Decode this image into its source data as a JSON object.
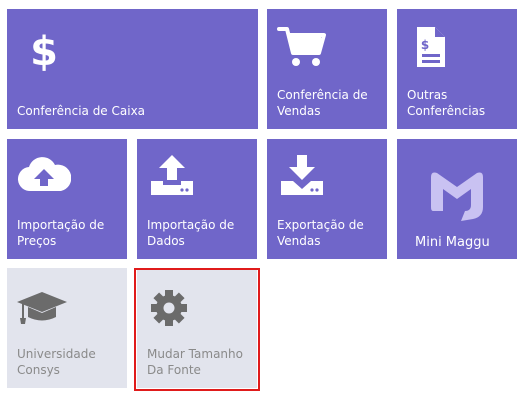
{
  "tiles": {
    "conferencia_caixa": {
      "label": "Conferência de Caixa",
      "icon": "dollar-icon"
    },
    "conferencia_vendas": {
      "label": "Conferência de\nVendas",
      "icon": "shopping-cart-icon"
    },
    "outras_conferencias": {
      "label": "Outras\nConferências",
      "icon": "invoice-icon"
    },
    "importacao_precos": {
      "label": "Importação de\nPreços",
      "icon": "cloud-upload-icon"
    },
    "importacao_dados": {
      "label": "Importação de\nDados",
      "icon": "upload-icon"
    },
    "exportacao_vendas": {
      "label": "Exportação de\nVendas",
      "icon": "download-icon"
    },
    "mini_maggu": {
      "label": "Mini Maggu",
      "icon": "maggu-logo-icon"
    },
    "universidade_consys": {
      "label": "Universidade\nConsys",
      "icon": "graduation-cap-icon"
    },
    "mudar_tamanho_fonte": {
      "label": "Mudar Tamanho\nDa Fonte",
      "icon": "gear-icon"
    }
  },
  "colors": {
    "tile_purple": "#7066c9",
    "tile_gray": "#e2e4ed",
    "highlight": "#e01b1b"
  }
}
